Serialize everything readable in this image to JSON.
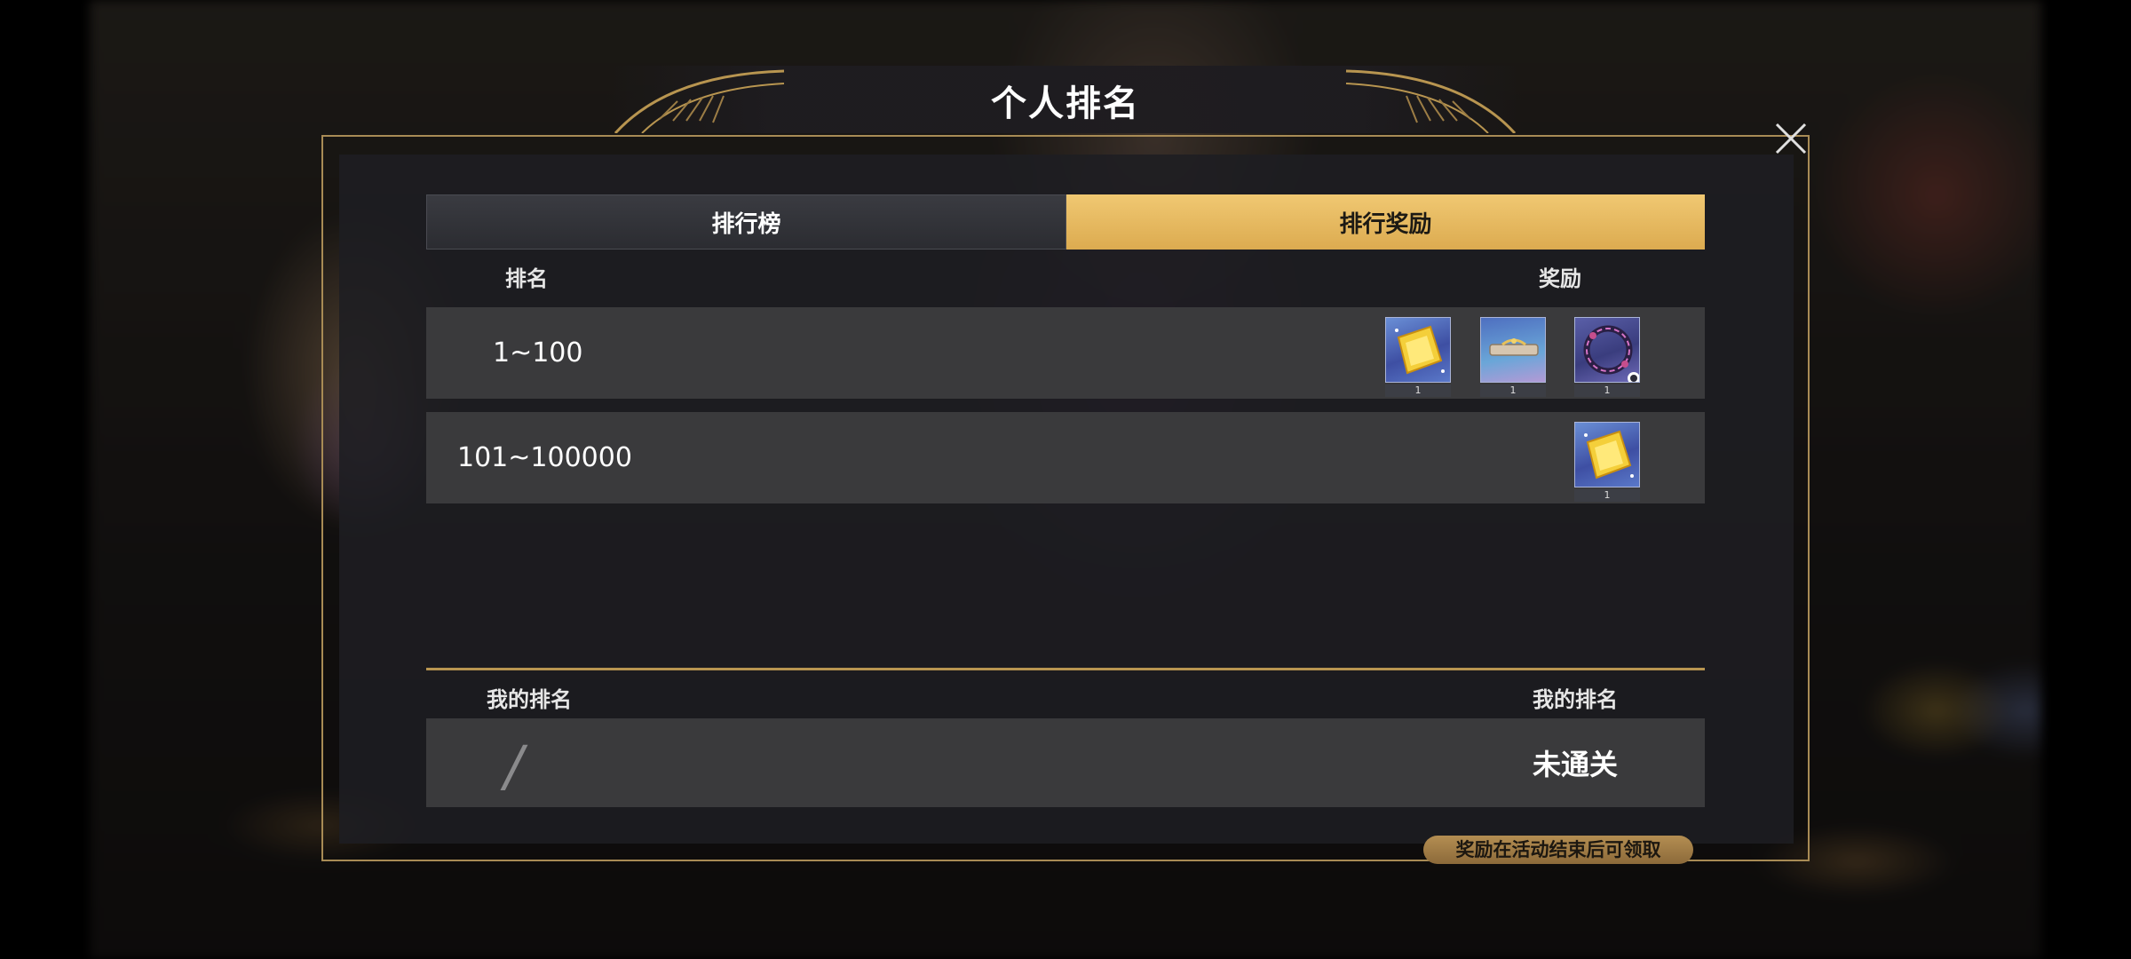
{
  "title": "个人排名",
  "tabs": [
    {
      "label": "排行榜",
      "active": false
    },
    {
      "label": "排行奖励",
      "active": true
    }
  ],
  "columns": {
    "rank": "排名",
    "reward": "奖励"
  },
  "reward_rows": [
    {
      "range": "1~100",
      "items": [
        {
          "icon": "gold-ticket-icon",
          "count": "1"
        },
        {
          "icon": "headband-icon",
          "count": "1"
        },
        {
          "icon": "ring-frame-icon",
          "count": "1"
        }
      ]
    },
    {
      "range": "101~100000",
      "items": [
        {
          "icon": "gold-ticket-icon",
          "count": "1"
        }
      ]
    }
  ],
  "my": {
    "left_label": "我的排名",
    "right_label": "我的排名",
    "rank": "/",
    "status": "未通关"
  },
  "note": "奖励在活动结束后可领取",
  "colors": {
    "accent_gold": "#e8bc65",
    "frame_gold": "#a88b55",
    "row_bg": "#3a3a3c"
  }
}
